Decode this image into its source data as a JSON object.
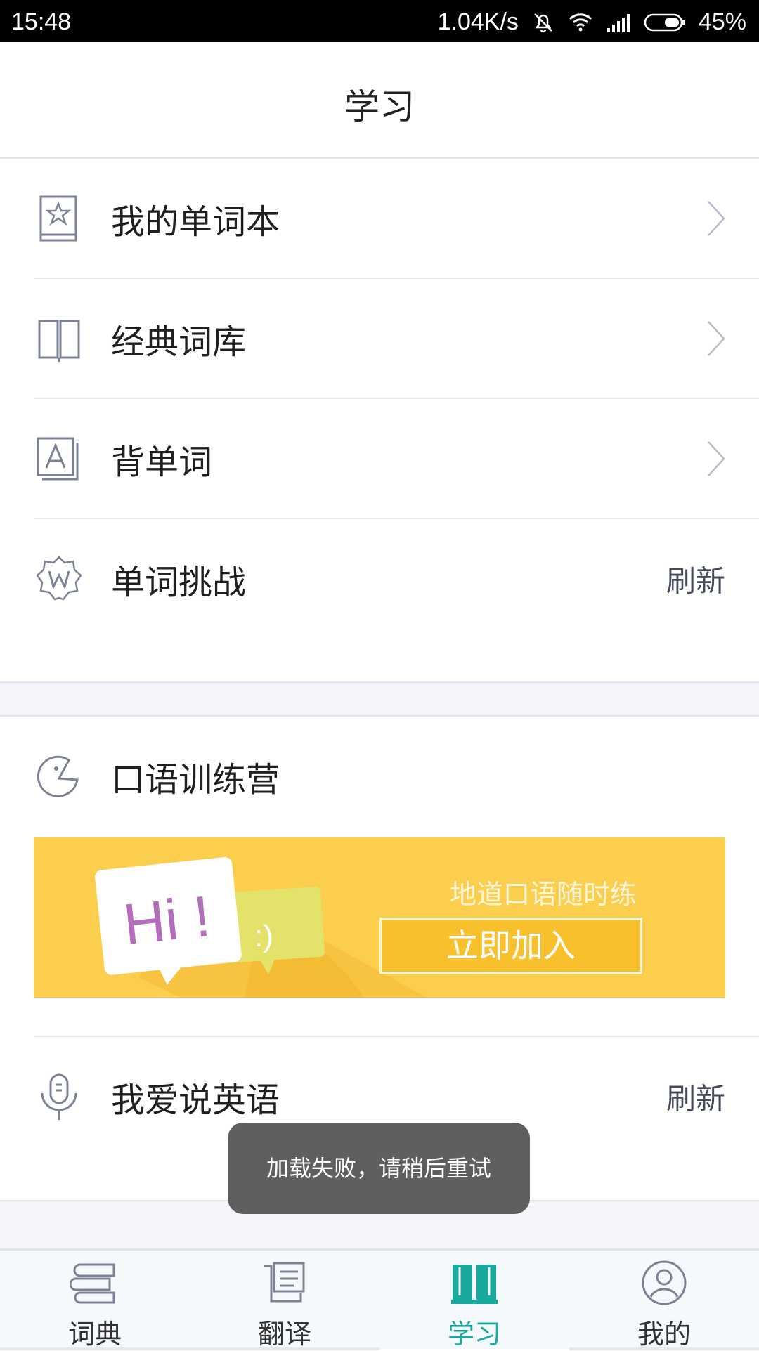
{
  "status_bar": {
    "time": "15:48",
    "net_speed": "1.04K/s",
    "battery": "45%",
    "icons": [
      "mute-icon",
      "wifi-icon",
      "signal-icon",
      "battery-icon"
    ]
  },
  "header": {
    "title": "学习"
  },
  "menu": {
    "wordbook": {
      "label": "我的单词本",
      "icon": "star-book-icon"
    },
    "classic_lib": {
      "label": "经典词库",
      "icon": "open-book-icon"
    },
    "memorize": {
      "label": "背单词",
      "icon": "letter-a-card-icon"
    },
    "challenge": {
      "label": "单词挑战",
      "icon": "w-badge-icon",
      "action": "刷新"
    }
  },
  "oral_section": {
    "title": "口语训练营",
    "icon": "pacman-icon",
    "banner": {
      "bubble_text": "Hi !",
      "bubble_face": ":)",
      "subtitle": "地道口语随时练",
      "join_label": "立即加入",
      "bg_color": "#fbcf4d"
    }
  },
  "speak": {
    "label": "我爱说英语",
    "icon": "microphone-icon",
    "action": "刷新"
  },
  "toast": {
    "text": "加载失败，请稍后重试"
  },
  "bottom_nav": {
    "active_color": "#19a99e",
    "items": [
      {
        "label": "词典",
        "icon": "books-stack-icon"
      },
      {
        "label": "翻译",
        "icon": "document-icon"
      },
      {
        "label": "学习",
        "icon": "open-book-icon"
      },
      {
        "label": "我的",
        "icon": "user-icon"
      }
    ]
  }
}
